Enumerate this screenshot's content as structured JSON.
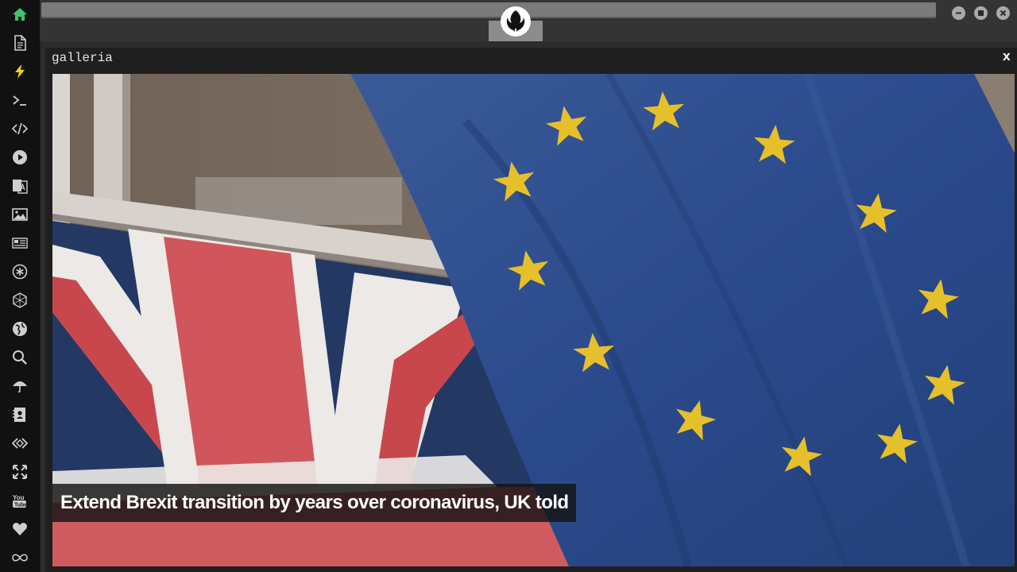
{
  "sidebar": {
    "items": [
      {
        "name": "home-icon",
        "color": "#3ec46d"
      },
      {
        "name": "document-icon"
      },
      {
        "name": "lightning-icon",
        "color": "#f2d21b"
      },
      {
        "name": "terminal-icon"
      },
      {
        "name": "code-icon"
      },
      {
        "name": "play-icon"
      },
      {
        "name": "translate-icon"
      },
      {
        "name": "image-icon"
      },
      {
        "name": "newspaper-icon"
      },
      {
        "name": "asterisk-icon"
      },
      {
        "name": "hexagon-icon"
      },
      {
        "name": "globe-icon"
      },
      {
        "name": "search-icon"
      },
      {
        "name": "umbrella-icon"
      },
      {
        "name": "contact-icon"
      },
      {
        "name": "diamond-code-icon"
      },
      {
        "name": "expand-icon"
      },
      {
        "name": "youtube-icon"
      },
      {
        "name": "heart-icon"
      },
      {
        "name": "infinity-icon"
      }
    ]
  },
  "topbar": {
    "logo": "rebel-alliance-icon",
    "window_controls": [
      "minimize-icon",
      "maximize-icon",
      "close-icon"
    ]
  },
  "panel": {
    "title": "galleria",
    "close_label": "x",
    "image": {
      "subject": "eu-and-union-jack-flags",
      "caption": "Extend Brexit transition by years over coronavirus, UK told"
    }
  },
  "colors": {
    "sidebar_bg": "#111111",
    "accent_green": "#3ec46d",
    "accent_yellow": "#f2d21b",
    "eu_blue": "#2b4a8c",
    "eu_star": "#e6c02a"
  }
}
